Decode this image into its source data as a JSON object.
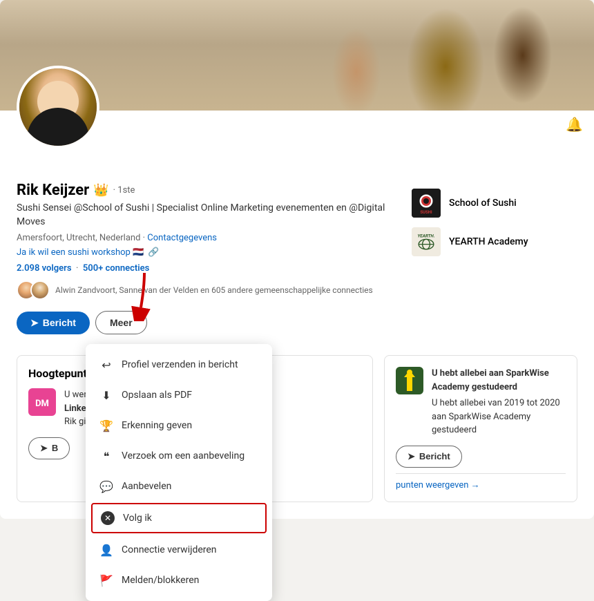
{
  "profile": {
    "name": "Rik Keijzer",
    "connection_level": "1ste",
    "headline": "Sushi Sensei @School of Sushi | Specialist Online Marketing evenementen en @Digital Moves",
    "location": "Amersfoort, Utrecht, Nederland",
    "contact_label": "Contactgegevens",
    "website_text": "Ja ik wil een sushi workshop 🇳🇱",
    "followers": "2.098 volgers",
    "connections": "500+ connecties",
    "mutual_text": "Alwin Zandvoort, Sanne van der Velden en 605 andere gemeenschappelijke connecties",
    "btn_message": "Bericht",
    "btn_more": "Meer"
  },
  "affiliations": [
    {
      "name": "School of Sushi",
      "type": "sushi"
    },
    {
      "name": "YEARTH Academy",
      "type": "yearth"
    }
  ],
  "dropdown": {
    "items": [
      {
        "label": "Profiel verzenden in bericht",
        "icon": "↩"
      },
      {
        "label": "Opslaan als PDF",
        "icon": "⬇"
      },
      {
        "label": "Erkenning geven",
        "icon": "🏆"
      },
      {
        "label": "Verzoek om een aanbeveling",
        "icon": "❝"
      },
      {
        "label": "Aanbevelen",
        "icon": "💬"
      },
      {
        "label": "Volg ik",
        "icon": "✕",
        "highlighted": true
      },
      {
        "label": "Connectie verwijderen",
        "icon": "👤"
      },
      {
        "label": "Melden/blokkeren",
        "icon": "🚩"
      }
    ]
  },
  "highlights": {
    "title": "Hoogtepunten",
    "item": {
      "text_prefix": "U werkt",
      "text_middle": "LinkedIn",
      "text_detail": "Rik ging Moves - slag",
      "logo_text": "DM",
      "btn_label": "B"
    }
  },
  "sparkwise": {
    "title": "U hebt allebei aan SparkWise Academy gestudeerd",
    "detail": "U hebt allebei van 2019 tot 2020 aan SparkWise Academy gestudeerd",
    "btn_label": "Bericht",
    "show_more": "punten weergeven →"
  }
}
